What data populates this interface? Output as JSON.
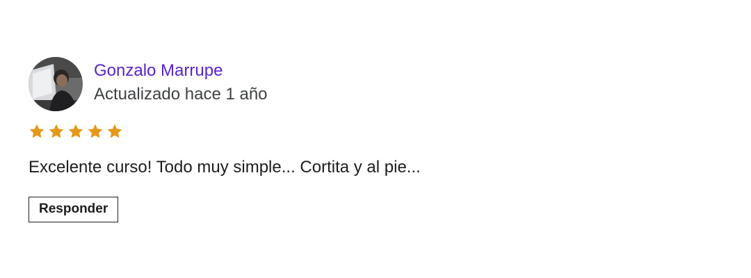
{
  "review": {
    "author": "Gonzalo Marrupe",
    "updated": "Actualizado hace 1 año",
    "rating": 5,
    "rating_max": 5,
    "text": "Excelente curso! Todo muy simple... Cortita y al pie...",
    "reply_label": "Responder",
    "avatar_icon": "user-photo-avatar"
  },
  "colors": {
    "author_link": "#5624d0",
    "star": "#e59819",
    "text": "#1c1d1f",
    "muted": "#3e4143"
  }
}
